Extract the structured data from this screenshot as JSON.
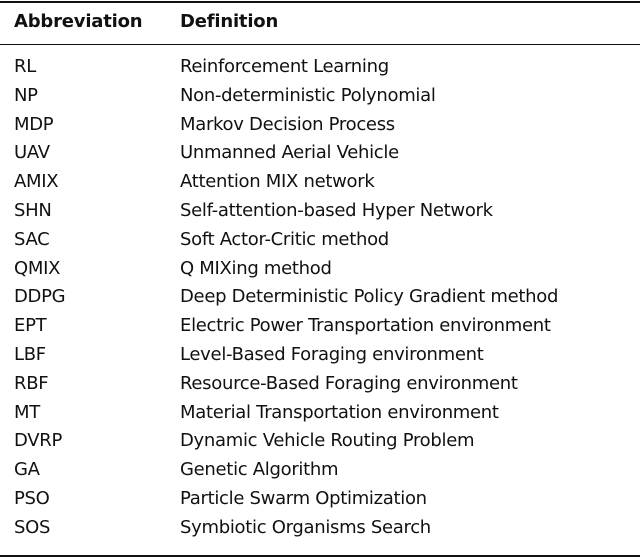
{
  "table": {
    "headers": {
      "abbreviation": "Abbreviation",
      "definition": "Definition"
    },
    "rows": [
      {
        "abbr": "RL",
        "def": "Reinforcement Learning"
      },
      {
        "abbr": "NP",
        "def": "Non-deterministic Polynomial"
      },
      {
        "abbr": "MDP",
        "def": "Markov Decision Process"
      },
      {
        "abbr": "UAV",
        "def": "Unmanned Aerial Vehicle"
      },
      {
        "abbr": "AMIX",
        "def": "Attention MIX network"
      },
      {
        "abbr": "SHN",
        "def": "Self-attention-based Hyper Network"
      },
      {
        "abbr": "SAC",
        "def": "Soft Actor-Critic method"
      },
      {
        "abbr": "QMIX",
        "def": "Q MIXing method"
      },
      {
        "abbr": "DDPG",
        "def": "Deep Deterministic Policy Gradient method"
      },
      {
        "abbr": "EPT",
        "def": "Electric Power Transportation environment"
      },
      {
        "abbr": "LBF",
        "def": "Level-Based Foraging environment"
      },
      {
        "abbr": "RBF",
        "def": "Resource-Based Foraging environment"
      },
      {
        "abbr": "MT",
        "def": "Material Transportation environment"
      },
      {
        "abbr": "DVRP",
        "def": "Dynamic Vehicle Routing Problem"
      },
      {
        "abbr": "GA",
        "def": "Genetic Algorithm"
      },
      {
        "abbr": "PSO",
        "def": "Particle Swarm Optimization"
      },
      {
        "abbr": "SOS",
        "def": "Symbiotic Organisms Search"
      }
    ]
  }
}
